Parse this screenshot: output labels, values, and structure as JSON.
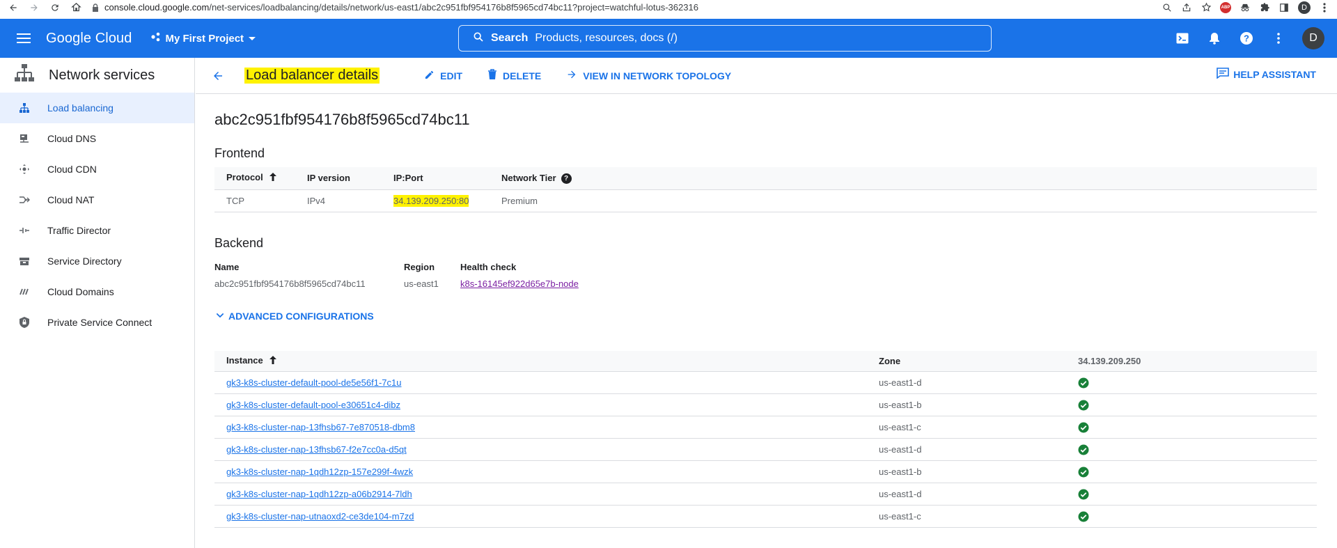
{
  "browser": {
    "url_host": "console.cloud.google.com",
    "url_path": "/net-services/loadbalancing/details/network/us-east1/abc2c951fbf954176b8f5965cd74bc11?project=watchful-lotus-362316",
    "abp_label": "ABP",
    "avatar_letter": "D"
  },
  "header": {
    "logo": "Google Cloud",
    "project": "My First Project",
    "search_label": "Search",
    "search_hint": "Products, resources, docs (/)",
    "avatar_letter": "D"
  },
  "sidebar": {
    "title": "Network services",
    "items": [
      {
        "label": "Load balancing",
        "icon": "load-balancing-icon"
      },
      {
        "label": "Cloud DNS",
        "icon": "dns-icon"
      },
      {
        "label": "Cloud CDN",
        "icon": "cdn-icon"
      },
      {
        "label": "Cloud NAT",
        "icon": "nat-icon"
      },
      {
        "label": "Traffic Director",
        "icon": "traffic-director-icon"
      },
      {
        "label": "Service Directory",
        "icon": "service-directory-icon"
      },
      {
        "label": "Cloud Domains",
        "icon": "domains-icon"
      },
      {
        "label": "Private Service Connect",
        "icon": "private-service-connect-icon"
      }
    ]
  },
  "toolbar": {
    "title": "Load balancer details",
    "edit": "EDIT",
    "delete": "DELETE",
    "topology": "VIEW IN NETWORK TOPOLOGY",
    "help": "HELP ASSISTANT"
  },
  "lb_name": "abc2c951fbf954176b8f5965cd74bc11",
  "frontend": {
    "title": "Frontend",
    "headers": [
      "Protocol",
      "IP version",
      "IP:Port",
      "Network Tier"
    ],
    "row": [
      "TCP",
      "IPv4",
      "34.139.209.250:80",
      "Premium"
    ]
  },
  "backend": {
    "title": "Backend",
    "headers": [
      "Name",
      "Region",
      "Health check"
    ],
    "values": [
      "abc2c951fbf954176b8f5965cd74bc11",
      "us-east1",
      "k8s-16145ef922d65e7b-node"
    ]
  },
  "advanced": "ADVANCED CONFIGURATIONS",
  "instances": {
    "headers": [
      "Instance",
      "Zone",
      "34.139.209.250"
    ],
    "rows": [
      {
        "name": "gk3-k8s-cluster-default-pool-de5e56f1-7c1u",
        "zone": "us-east1-d"
      },
      {
        "name": "gk3-k8s-cluster-default-pool-e30651c4-dibz",
        "zone": "us-east1-b"
      },
      {
        "name": "gk3-k8s-cluster-nap-13fhsb67-7e870518-dbm8",
        "zone": "us-east1-c"
      },
      {
        "name": "gk3-k8s-cluster-nap-13fhsb67-f2e7cc0a-d5qt",
        "zone": "us-east1-d"
      },
      {
        "name": "gk3-k8s-cluster-nap-1qdh12zp-157e299f-4wzk",
        "zone": "us-east1-b"
      },
      {
        "name": "gk3-k8s-cluster-nap-1qdh12zp-a06b2914-7ldh",
        "zone": "us-east1-d"
      },
      {
        "name": "gk3-k8s-cluster-nap-utnaoxd2-ce3de104-m7zd",
        "zone": "us-east1-c"
      }
    ]
  },
  "colors": {
    "brand": "#1a73e8",
    "highlight": "#fff200",
    "healthy": "#188038",
    "visited_link": "#7b1fa2"
  }
}
